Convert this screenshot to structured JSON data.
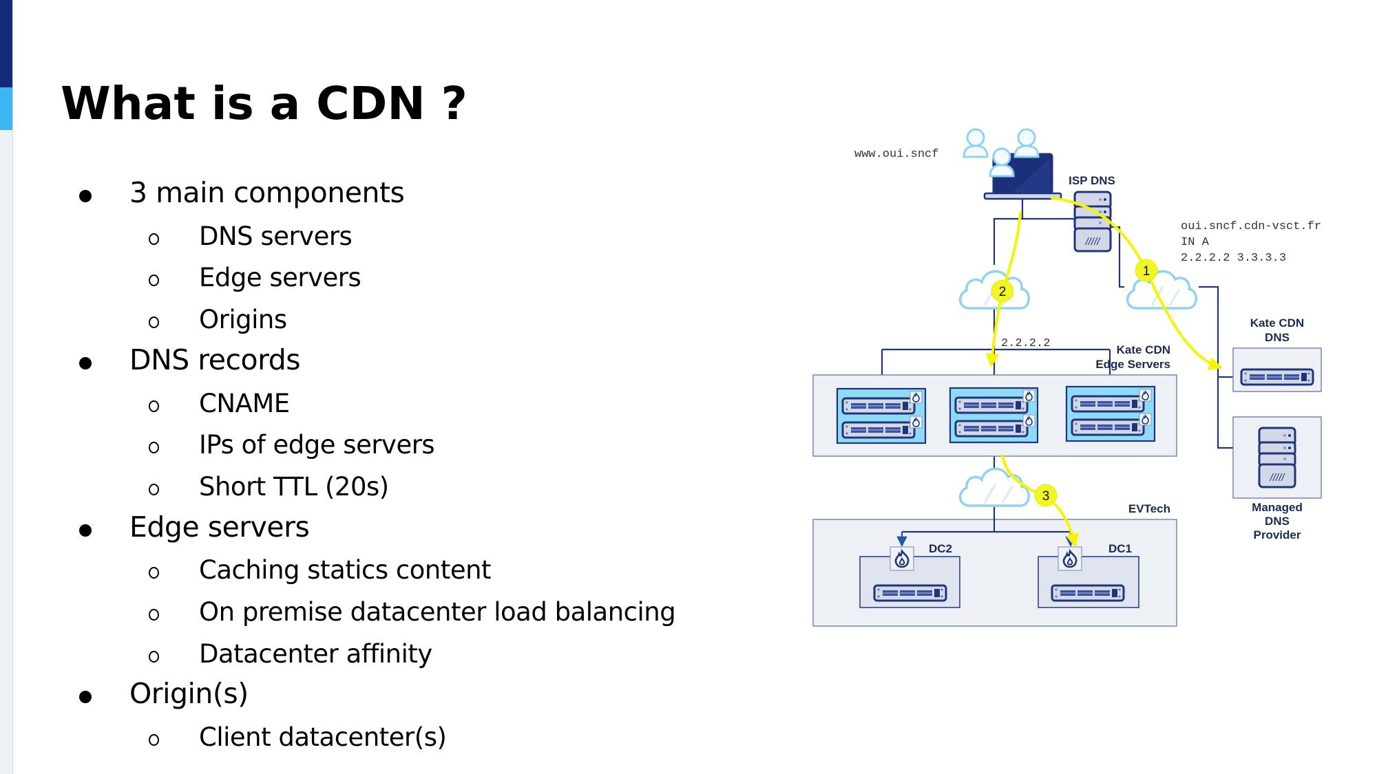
{
  "slide": {
    "title": "What is a CDN ?",
    "colors": {
      "accent_dark": "#152a78",
      "accent_light": "#3cb6f2",
      "line": "#1e3577",
      "flow": "#f5f500"
    }
  },
  "bullets": [
    {
      "level": 1,
      "text": "3 main components"
    },
    {
      "level": 2,
      "text": "DNS servers"
    },
    {
      "level": 2,
      "text": "Edge servers"
    },
    {
      "level": 2,
      "text": "Origins"
    },
    {
      "level": 1,
      "text": "DNS records"
    },
    {
      "level": 2,
      "text": "CNAME"
    },
    {
      "level": 2,
      "text": "IPs of edge servers"
    },
    {
      "level": 2,
      "text": "Short TTL (20s)"
    },
    {
      "level": 1,
      "text": "Edge servers"
    },
    {
      "level": 2,
      "text": "Caching statics content"
    },
    {
      "level": 2,
      "text": "On premise datacenter load balancing"
    },
    {
      "level": 2,
      "text": "Datacenter affinity"
    },
    {
      "level": 1,
      "text": "Origin(s)"
    },
    {
      "level": 2,
      "text": "Client datacenter(s)"
    }
  ],
  "diagram": {
    "client_url": "www.oui.sncf",
    "isp_dns_label": "ISP DNS",
    "dns_response": {
      "line1": "oui.sncf.cdn-vsct.fr",
      "line2": "IN A",
      "line3": "2.2.2.2 3.3.3.3"
    },
    "kate_cdn_dns_label": {
      "line1": "Kate CDN",
      "line2": "DNS"
    },
    "managed_dns_label": {
      "line1": "Managed",
      "line2": "DNS",
      "line3": "Provider"
    },
    "edge_ip": "2.2.2.2",
    "edge_servers_label": {
      "line1": "Kate CDN",
      "line2": "Edge Servers"
    },
    "origin_label": "EVTech",
    "dc2_label": "DC2",
    "dc1_label": "DC1",
    "steps": [
      "1",
      "2",
      "3"
    ]
  }
}
